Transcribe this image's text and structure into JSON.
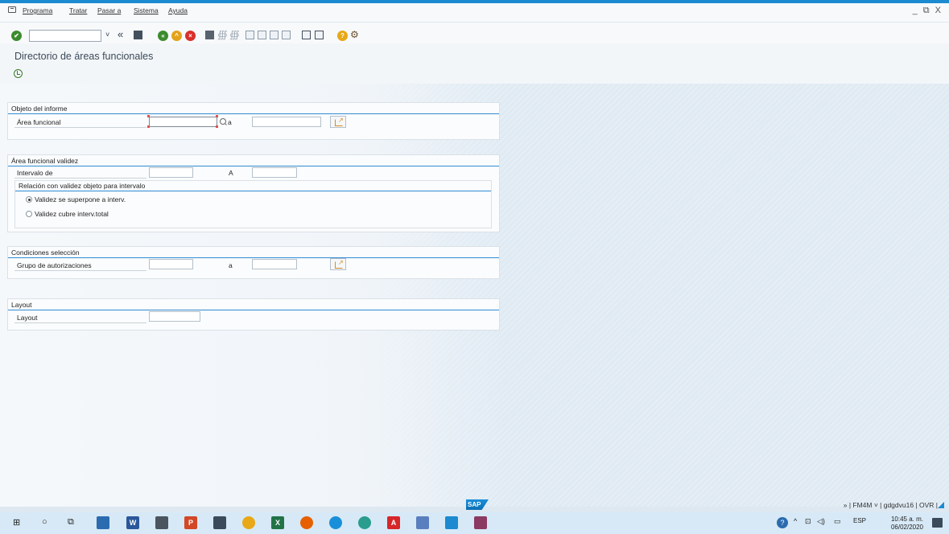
{
  "menu": {
    "items": [
      {
        "label": "Programa"
      },
      {
        "label": "Tratar"
      },
      {
        "label": "Pasar a"
      },
      {
        "label": "Sistema"
      },
      {
        "label": "Ayuda"
      }
    ],
    "window_controls": "_ ⧉ X"
  },
  "toolbar": {
    "command_field_value": "",
    "icons": [
      "check-icon",
      "back-double-icon",
      "save-icon",
      "back-icon",
      "exit-icon",
      "cancel-icon",
      "print-icon",
      "find-icon",
      "find-next-icon",
      "first-page-icon",
      "prev-page-icon",
      "next-page-icon",
      "last-page-icon",
      "new-session-icon",
      "shortcut-icon",
      "help-icon",
      "settings-icon"
    ]
  },
  "page": {
    "title": "Directorio de áreas funcionales"
  },
  "groups": {
    "objeto": {
      "title": "Objeto del informe",
      "area_label": "Área funcional",
      "to_label": "a",
      "from_value": "",
      "to_value": ""
    },
    "validez": {
      "title": "Área funcional validez",
      "interval_label": "Intervalo de",
      "to_label": "A",
      "from_value": "",
      "to_value": "",
      "sub_title": "Relación con validez objeto para intervalo",
      "radio1": "Validez se superpone a interv.",
      "radio2": "Validez cubre interv.total",
      "selected": 1
    },
    "condiciones": {
      "title": "Condiciones selección",
      "group_label": "Grupo de autorizaciones",
      "to_label": "a",
      "from_value": "",
      "to_value": ""
    },
    "layout": {
      "title": "Layout",
      "layout_label": "Layout",
      "value": ""
    }
  },
  "status": {
    "logo": "SAP",
    "info": "» | FM4M ˅ | gdgdvu16 | OVR |"
  },
  "taskbar": {
    "apps": [
      {
        "name": "word",
        "letter": "W",
        "color": "#2b579a"
      },
      {
        "name": "powerpoint",
        "letter": "P",
        "color": "#d24726"
      },
      {
        "name": "excel",
        "letter": "X",
        "color": "#217346"
      },
      {
        "name": "acrobat",
        "letter": "A",
        "color": "#d7262a"
      }
    ],
    "language": "ESP",
    "time": "10:45 a. m.",
    "date": "06/02/2020"
  }
}
